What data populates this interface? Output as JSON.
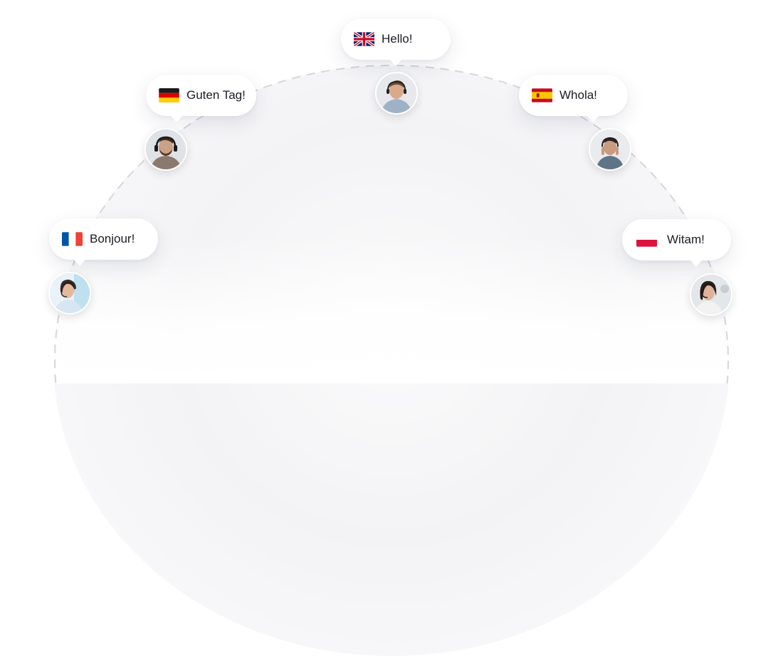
{
  "greetings": {
    "uk": {
      "text": "Hello!",
      "flag": "uk-flag-icon"
    },
    "de": {
      "text": "Guten Tag!",
      "flag": "germany-flag-icon"
    },
    "es": {
      "text": "Whola!",
      "flag": "spain-flag-icon"
    },
    "fr": {
      "text": "Bonjour!",
      "flag": "france-flag-icon"
    },
    "pl": {
      "text": "Witam!",
      "flag": "poland-flag-icon"
    }
  },
  "colors": {
    "arc_dash": "#d6d6dc",
    "text": "#1c1c24",
    "bubble_bg": "#ffffff"
  }
}
